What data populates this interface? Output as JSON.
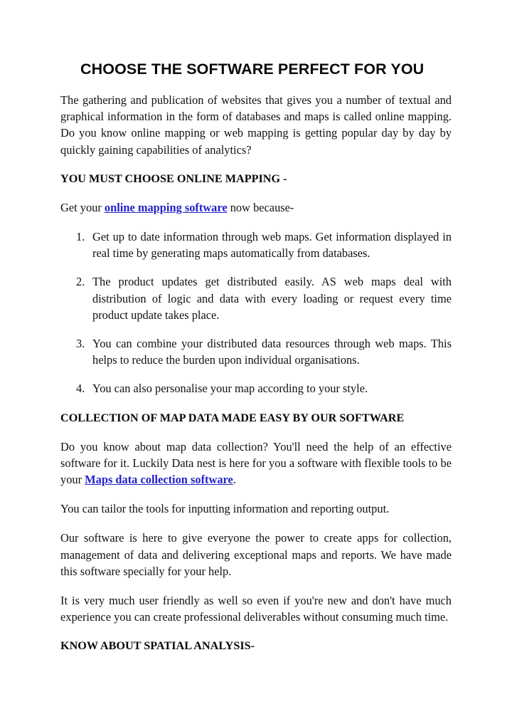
{
  "document": {
    "title": "CHOOSE THE SOFTWARE PERFECT FOR YOU",
    "link_color": "#2222CC",
    "text_color": "#111111",
    "background_color": "#FFFFFF",
    "intro_paragraph": "The gathering and publication of websites that gives you a number of textual and graphical information in the form of databases and maps is called online mapping. Do you know online mapping or web mapping is getting popular day by day by quickly gaining capabilities of analytics?",
    "heading_1": "YOU MUST CHOOSE ONLINE MAPPING -",
    "lead_in": {
      "before": "Get your ",
      "link_text": "online mapping software",
      "after": " now because-"
    },
    "list_items": [
      "Get up to date information through web maps. Get information displayed in real time by generating maps automatically from databases.",
      "The product updates get distributed easily. AS web maps deal with distribution of logic and data with every loading or request every time product update takes place.",
      "You can combine your distributed data resources through web maps. This helps to reduce the burden upon individual organisations.",
      "You can also personalise your map according to your style."
    ],
    "heading_2": "COLLECTION OF MAP DATA MADE EASY BY OUR SOFTWARE",
    "paragraph_collection": {
      "before": "Do you know about map data collection? You'll need the help of an effective software for it. Luckily Data nest is here for you a software with flexible tools to be your ",
      "link_text": "Maps data collection software",
      "after": "."
    },
    "paragraph_tailor": "You can tailor the tools for inputting information and reporting output.",
    "paragraph_power": "Our software is here to give everyone the power to create apps for collection, management of data and delivering exceptional maps and reports. We have made this software specially for your help.",
    "paragraph_friendly": "It is very much user friendly as well so even if you're new and don't have much experience you can create professional deliverables without consuming much time.",
    "heading_3": "KNOW ABOUT SPATIAL ANALYSIS-"
  }
}
